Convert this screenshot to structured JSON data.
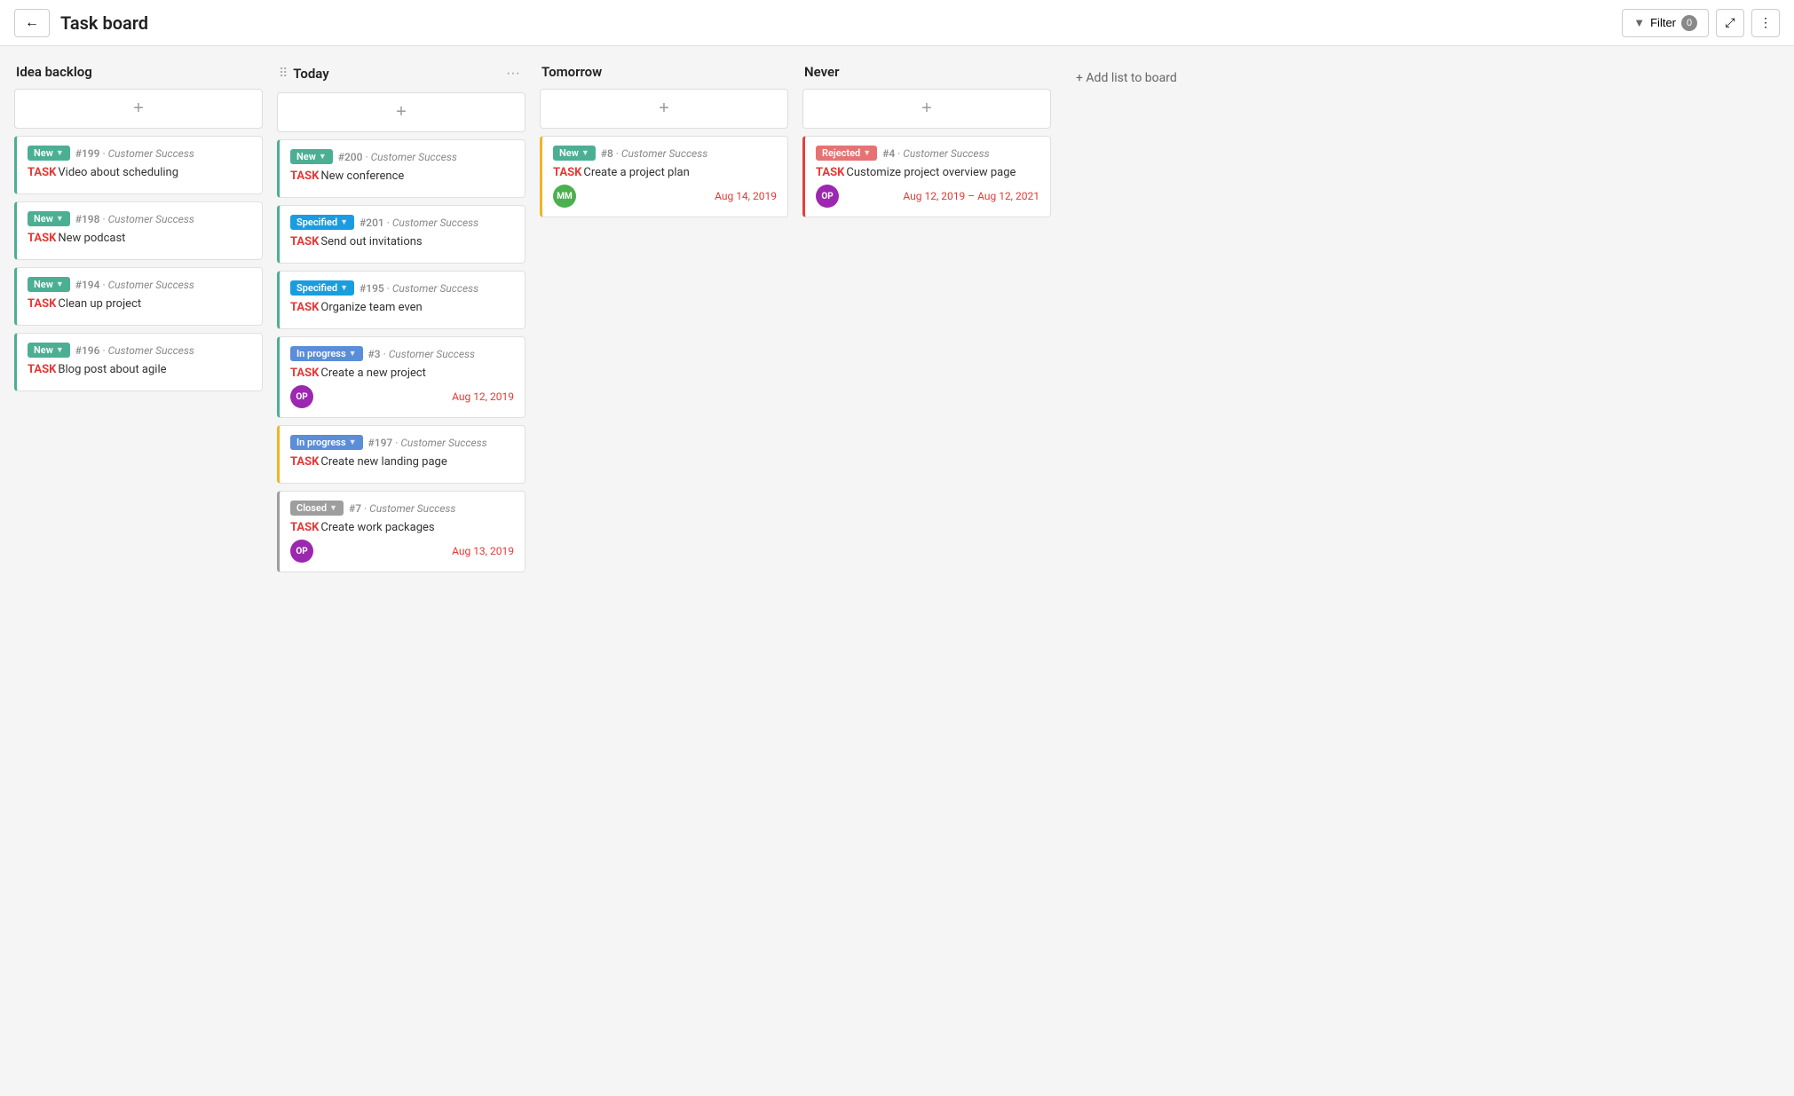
{
  "header": {
    "back_label": "←",
    "title": "Task board",
    "filter_label": "Filter",
    "filter_count": "0",
    "expand_icon": "⤢",
    "more_icon": "⋮"
  },
  "add_list_label": "+ Add list to board",
  "columns": [
    {
      "id": "idea-backlog",
      "title": "Idea backlog",
      "has_drag": false,
      "has_more": false,
      "cards": [
        {
          "id": "c1",
          "border": "green",
          "status": "New",
          "status_class": "status-new",
          "number": "#199",
          "project": "Customer Success",
          "title": "Video about scheduling",
          "avatar": null,
          "date": null
        },
        {
          "id": "c2",
          "border": "green",
          "status": "New",
          "status_class": "status-new",
          "number": "#198",
          "project": "Customer Success",
          "title": "New podcast",
          "avatar": null,
          "date": null
        },
        {
          "id": "c3",
          "border": "green",
          "status": "New",
          "status_class": "status-new",
          "number": "#194",
          "project": "Customer Success",
          "title": "Clean up project",
          "avatar": null,
          "date": null
        },
        {
          "id": "c4",
          "border": "green",
          "status": "New",
          "status_class": "status-new",
          "number": "#196",
          "project": "Customer Success",
          "title": "Blog post about agile",
          "avatar": null,
          "date": null
        }
      ]
    },
    {
      "id": "today",
      "title": "Today",
      "has_drag": true,
      "has_more": true,
      "cards": [
        {
          "id": "c5",
          "border": "green",
          "status": "New",
          "status_class": "status-new",
          "number": "#200",
          "project": "Customer Success",
          "title": "New conference",
          "avatar": null,
          "date": null
        },
        {
          "id": "c6",
          "border": "green",
          "status": "Specified",
          "status_class": "status-specified",
          "number": "#201",
          "project": "Customer Success",
          "title": "Send out invitations",
          "avatar": null,
          "date": null
        },
        {
          "id": "c7",
          "border": "green",
          "status": "Specified",
          "status_class": "status-specified",
          "number": "#195",
          "project": "Customer Success",
          "title": "Organize team even",
          "avatar": null,
          "date": null
        },
        {
          "id": "c8",
          "border": "green",
          "status": "In progress",
          "status_class": "status-inprogress",
          "number": "#3",
          "project": "Customer Success",
          "title": "Create a new project",
          "avatar": "OP",
          "avatar_class": "avatar-op",
          "date": "Aug 12, 2019"
        },
        {
          "id": "c9",
          "border": "yellow",
          "status": "In progress",
          "status_class": "status-inprogress",
          "number": "#197",
          "project": "Customer Success",
          "title": "Create new landing page",
          "avatar": null,
          "date": null
        },
        {
          "id": "c10",
          "border": "gray",
          "status": "Closed",
          "status_class": "status-closed",
          "number": "#7",
          "project": "Customer Success",
          "title": "Create work packages",
          "avatar": "OP",
          "avatar_class": "avatar-op",
          "date": "Aug 13, 2019"
        }
      ]
    },
    {
      "id": "tomorrow",
      "title": "Tomorrow",
      "has_drag": false,
      "has_more": false,
      "cards": [
        {
          "id": "c11",
          "border": "yellow",
          "status": "New",
          "status_class": "status-new",
          "number": "#8",
          "project": "Customer Success",
          "title": "Create a project plan",
          "avatar": "MM",
          "avatar_class": "avatar-mm",
          "date": "Aug 14, 2019"
        }
      ]
    },
    {
      "id": "never",
      "title": "Never",
      "has_drag": false,
      "has_more": false,
      "cards": [
        {
          "id": "c12",
          "border": "red",
          "status": "Rejected",
          "status_class": "status-rejected",
          "number": "#4",
          "project": "Customer Success",
          "title": "Customize project overview page",
          "avatar": "OP",
          "avatar_class": "avatar-op",
          "date": "Aug 12, 2019 – Aug 12, 2021"
        }
      ]
    }
  ]
}
